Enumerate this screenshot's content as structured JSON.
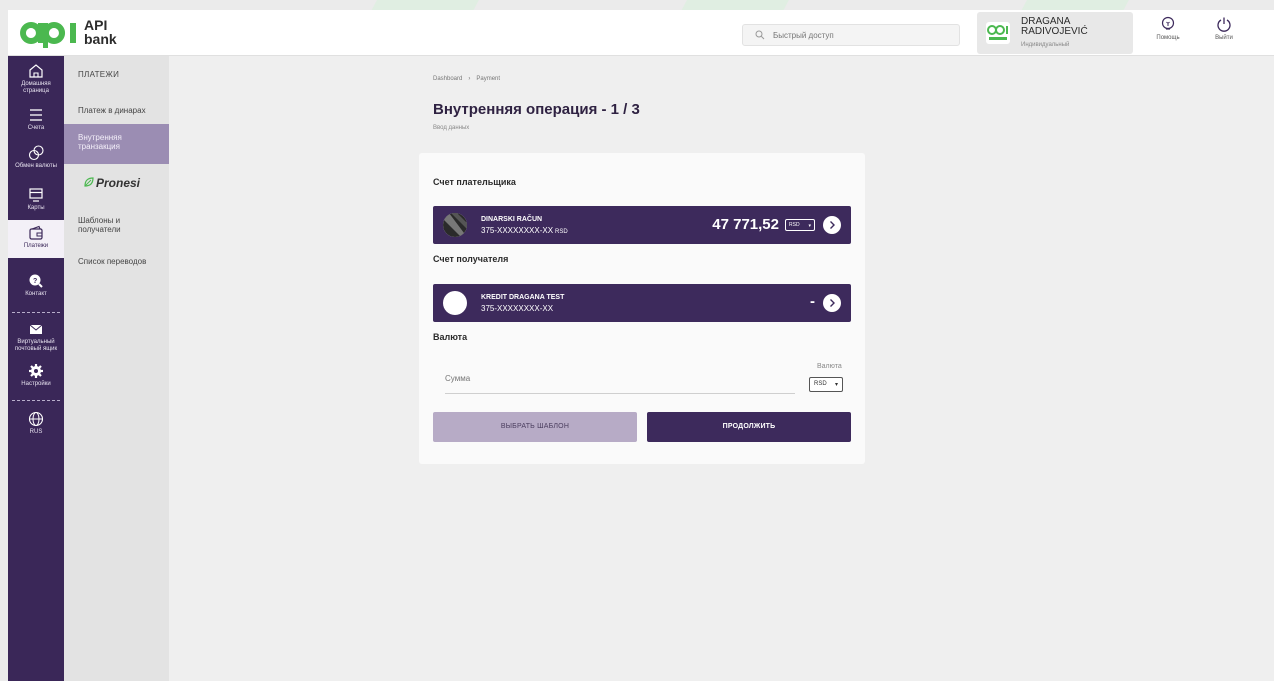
{
  "brand": {
    "logo_text_line1": "API",
    "logo_text_line2": "bank",
    "logo_mark": "api",
    "accent": "#3d2a5c",
    "logo_green": "#4bb84f"
  },
  "header": {
    "search_placeholder": "Быстрый доступ",
    "user_name": "DRAGANA RADIVOJEVIĆ",
    "user_role": "Индивидуальный",
    "user_avatar_text": "api",
    "user_avatar_subtext": "api bank",
    "help_label": "Помощь",
    "logout_label": "Выйти"
  },
  "rail": {
    "items": [
      {
        "label": "Домашняя страница",
        "icon": "home-icon"
      },
      {
        "label": "Счета",
        "icon": "list-icon"
      },
      {
        "label": "Обмен валюты",
        "icon": "exchange-icon"
      },
      {
        "label": "Карты",
        "icon": "card-icon"
      },
      {
        "label": "Платежи",
        "icon": "wallet-icon"
      },
      {
        "label": "Контакт",
        "icon": "chat-icon"
      },
      {
        "label": "Виртуальный почтовый ящик",
        "icon": "mail-icon"
      },
      {
        "label": "Настройки",
        "icon": "gear-icon"
      },
      {
        "label": "RUS",
        "icon": "globe-icon"
      }
    ]
  },
  "submenu": {
    "heading": "ПЛАТЕЖИ",
    "items": [
      {
        "label": "Платеж в динарах"
      },
      {
        "label": "Внутренняя транзакция"
      },
      {
        "label": "Pronesi"
      },
      {
        "label": "Шаблоны и получатели"
      },
      {
        "label": "Список переводов"
      }
    ]
  },
  "breadcrumb": {
    "items": [
      "Dashboard",
      "Payment"
    ],
    "separator": "›"
  },
  "page": {
    "title": "Внутренняя операция - 1 / 3",
    "subtitle": "Ввод данных"
  },
  "form": {
    "payer_label": "Счет плательщика",
    "payer": {
      "name": "DINARSKI RAČUN",
      "number": "375-XXXXXXXX-XX",
      "number_currency": "RSD",
      "balance": "47 771,52",
      "currency": "RSD"
    },
    "recipient_label": "Счет получателя",
    "recipient": {
      "name": "KREDIT DRAGANA TEST",
      "number": "375-XXXXXXXX-XX",
      "balance": "-"
    },
    "currency_section_label": "Валюта",
    "amount_placeholder": "Сумма",
    "currency_field_label": "Валюта",
    "currency_value": "RSD",
    "template_button": "ВЫБРАТЬ ШАБЛОН",
    "continue_button": "ПРОДОЛЖИТЬ"
  }
}
